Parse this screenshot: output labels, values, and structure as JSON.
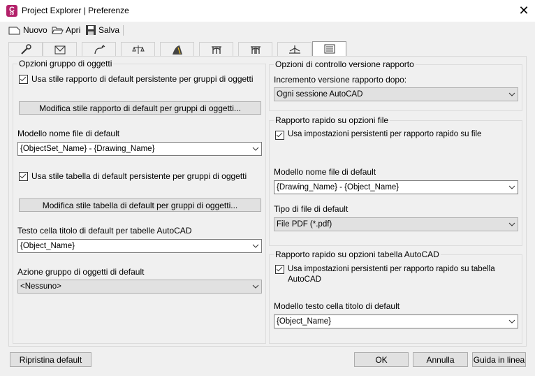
{
  "window": {
    "title": "Project Explorer | Preferenze",
    "app_icon_letter": "C",
    "app_icon_sub": "3D"
  },
  "toolbar": {
    "new_label": "Nuovo",
    "open_label": "Apri",
    "save_label": "Salva"
  },
  "tabs": [
    {
      "icon": "wrench-icon"
    },
    {
      "icon": "envelope-icon"
    },
    {
      "icon": "alignment-icon"
    },
    {
      "icon": "scales-icon"
    },
    {
      "icon": "road-icon"
    },
    {
      "icon": "bridge-icon"
    },
    {
      "icon": "bridge-pier-icon"
    },
    {
      "icon": "profile-view-icon"
    },
    {
      "icon": "report-icon"
    }
  ],
  "left_group": {
    "title": "Opzioni gruppo di oggetti",
    "use_report_style_label": "Usa stile rapporto di default persistente per gruppi di oggetti",
    "edit_report_style_button": "Modifica stile rapporto di default per gruppi di oggetti...",
    "filename_template_label": "Modello nome file di default",
    "filename_template_value": "{ObjectSet_Name} - {Drawing_Name}",
    "use_table_style_label": "Usa stile tabella di default persistente per gruppi di oggetti",
    "edit_table_style_button": "Modifica stile tabella di default per gruppi di oggetti...",
    "title_cell_label": "Testo cella titolo di default per tabelle AutoCAD",
    "title_cell_value": "{Object_Name}",
    "action_label": "Azione gruppo di oggetti di default",
    "action_value": "<Nessuno>"
  },
  "version_group": {
    "title": "Opzioni di controllo versione rapporto",
    "increment_label": "Incremento versione rapporto dopo:",
    "increment_value": "Ogni sessione AutoCAD"
  },
  "file_group": {
    "title": "Rapporto rapido su opzioni file",
    "use_persistent_label": "Usa impostazioni persistenti per rapporto rapido su file",
    "filename_template_label": "Modello nome file di default",
    "filename_template_value": "{Drawing_Name} - {Object_Name}",
    "file_type_label": "Tipo di file di default",
    "file_type_value": "File PDF (*.pdf)"
  },
  "table_group": {
    "title": "Rapporto rapido su opzioni tabella AutoCAD",
    "use_persistent_label": "Usa impostazioni persistenti per rapporto rapido su tabella AutoCAD",
    "title_cell_label": "Modello testo cella titolo di default",
    "title_cell_value": "{Object_Name}"
  },
  "footer": {
    "reset_label": "Ripristina default",
    "ok_label": "OK",
    "cancel_label": "Annulla",
    "help_label": "Guida in linea"
  }
}
